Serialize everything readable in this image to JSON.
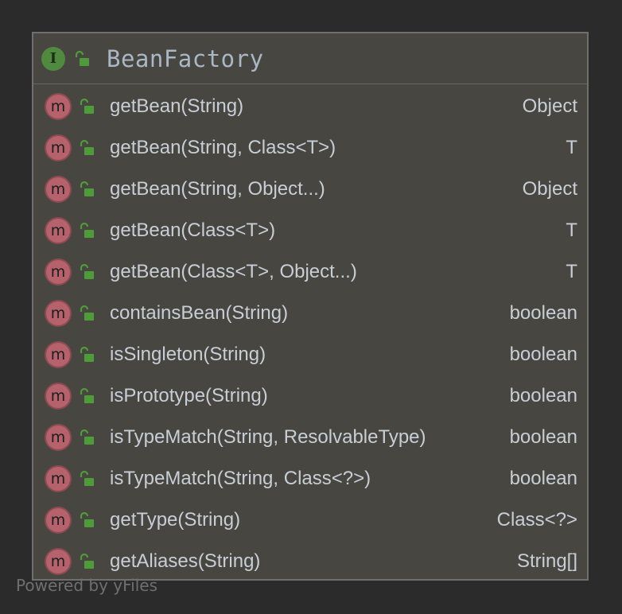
{
  "class_box": {
    "title": "BeanFactory",
    "kind_icon": "interface-icon",
    "kind_letter": "I",
    "visibility_icon": "unlocked-public-icon"
  },
  "methods": [
    {
      "name": "getBean(String)",
      "type": "Object",
      "icon_letter": "m"
    },
    {
      "name": "getBean(String, Class<T>)",
      "type": "T",
      "icon_letter": "m"
    },
    {
      "name": "getBean(String, Object...)",
      "type": "Object",
      "icon_letter": "m"
    },
    {
      "name": "getBean(Class<T>)",
      "type": "T",
      "icon_letter": "m"
    },
    {
      "name": "getBean(Class<T>, Object...)",
      "type": "T",
      "icon_letter": "m"
    },
    {
      "name": "containsBean(String)",
      "type": "boolean",
      "icon_letter": "m"
    },
    {
      "name": "isSingleton(String)",
      "type": "boolean",
      "icon_letter": "m"
    },
    {
      "name": "isPrototype(String)",
      "type": "boolean",
      "icon_letter": "m"
    },
    {
      "name": "isTypeMatch(String, ResolvableType)",
      "type": "boolean",
      "icon_letter": "m"
    },
    {
      "name": "isTypeMatch(String, Class<?>)",
      "type": "boolean",
      "icon_letter": "m"
    },
    {
      "name": "getType(String)",
      "type": "Class<?>",
      "icon_letter": "m"
    },
    {
      "name": "getAliases(String)",
      "type": "String[]",
      "icon_letter": "m"
    }
  ],
  "footer": {
    "text": "Powered by yFiles"
  },
  "colors": {
    "background": "#2b2b2b",
    "box_fill": "#484641",
    "box_border": "#6f6f6f",
    "interface_green": "#4f8a3f",
    "method_red": "#b5626c",
    "lock_green": "#4f9a3a",
    "text": "#c8ced6",
    "title_text": "#a9b7c6"
  }
}
